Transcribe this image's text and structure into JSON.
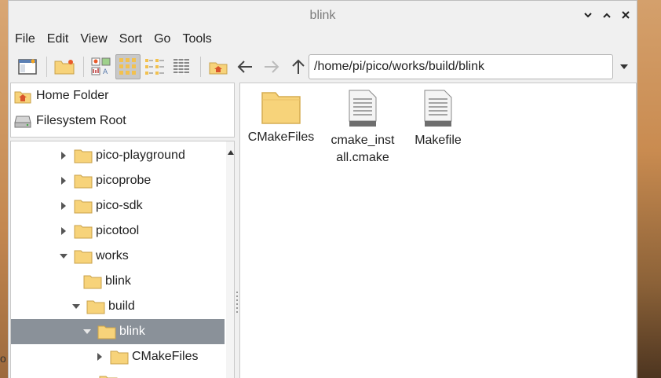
{
  "window": {
    "title": "blink"
  },
  "menu": [
    "File",
    "Edit",
    "View",
    "Sort",
    "Go",
    "Tools"
  ],
  "location": {
    "path": "/home/pi/pico/works/build/blink"
  },
  "places": [
    {
      "label": "Home Folder",
      "icon": "home-icon"
    },
    {
      "label": "Filesystem Root",
      "icon": "drive-icon"
    }
  ],
  "tree": [
    {
      "label": "pico-playground",
      "state": "collapsed",
      "depth": 0
    },
    {
      "label": "picoprobe",
      "state": "collapsed",
      "depth": 0
    },
    {
      "label": "pico-sdk",
      "state": "collapsed",
      "depth": 0
    },
    {
      "label": "picotool",
      "state": "collapsed",
      "depth": 0
    },
    {
      "label": "works",
      "state": "expanded",
      "depth": 0
    },
    {
      "label": "blink",
      "state": "leaf",
      "depth": 1
    },
    {
      "label": "build",
      "state": "expanded",
      "depth": 1
    },
    {
      "label": "blink",
      "state": "expanded",
      "depth": 2,
      "selected": true
    },
    {
      "label": "CMakeFiles",
      "state": "collapsed",
      "depth": 3
    }
  ],
  "files": [
    {
      "name": "CMakeFiles",
      "type": "folder"
    },
    {
      "name": "cmake_install.cmake",
      "line1": "cmake_inst",
      "line2": "all.cmake",
      "type": "text"
    },
    {
      "name": "Makefile",
      "type": "text"
    }
  ],
  "colors": {
    "folder": "#f7d37a",
    "selection": "#8a9199",
    "home": "#d9542b"
  }
}
